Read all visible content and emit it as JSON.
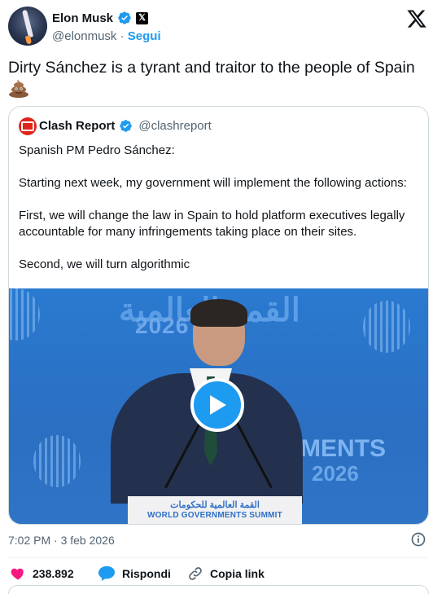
{
  "author": {
    "name": "Elon Musk",
    "handle": "@elonmusk",
    "separator": "·",
    "follow_label": "Segui"
  },
  "tweet": {
    "text": "Dirty Sánchez is a tyrant and traitor to the people of Spain",
    "emoji": "pile-of-poo-icon"
  },
  "quote": {
    "name": "Clash Report",
    "handle": "@clashreport",
    "paragraphs": [
      "Spanish PM Pedro Sánchez:",
      "Starting next week, my government will implement the following actions:",
      "First, we will change the law in Spain to hold platform executives legally accountable for many infringements taking place on their sites.",
      "Second, we will turn algorithmic"
    ],
    "video": {
      "bg_arabic": "القمة العالمية",
      "bg_year": "2026",
      "bg_ments": "MENTS",
      "bg_year_2": "2026",
      "podium_arabic": "القمة العالمية للحكومات",
      "podium_english": "WORLD GOVERNMENTS SUMMIT"
    }
  },
  "timestamp": "7:02 PM · 3 feb 2026",
  "actions": {
    "likes": "238.892",
    "reply_label": "Rispondi",
    "copy_link_label": "Copia link"
  },
  "colors": {
    "accent": "#1d9bf0",
    "like": "#f91880",
    "text": "#0f1419",
    "muted": "#536471"
  }
}
